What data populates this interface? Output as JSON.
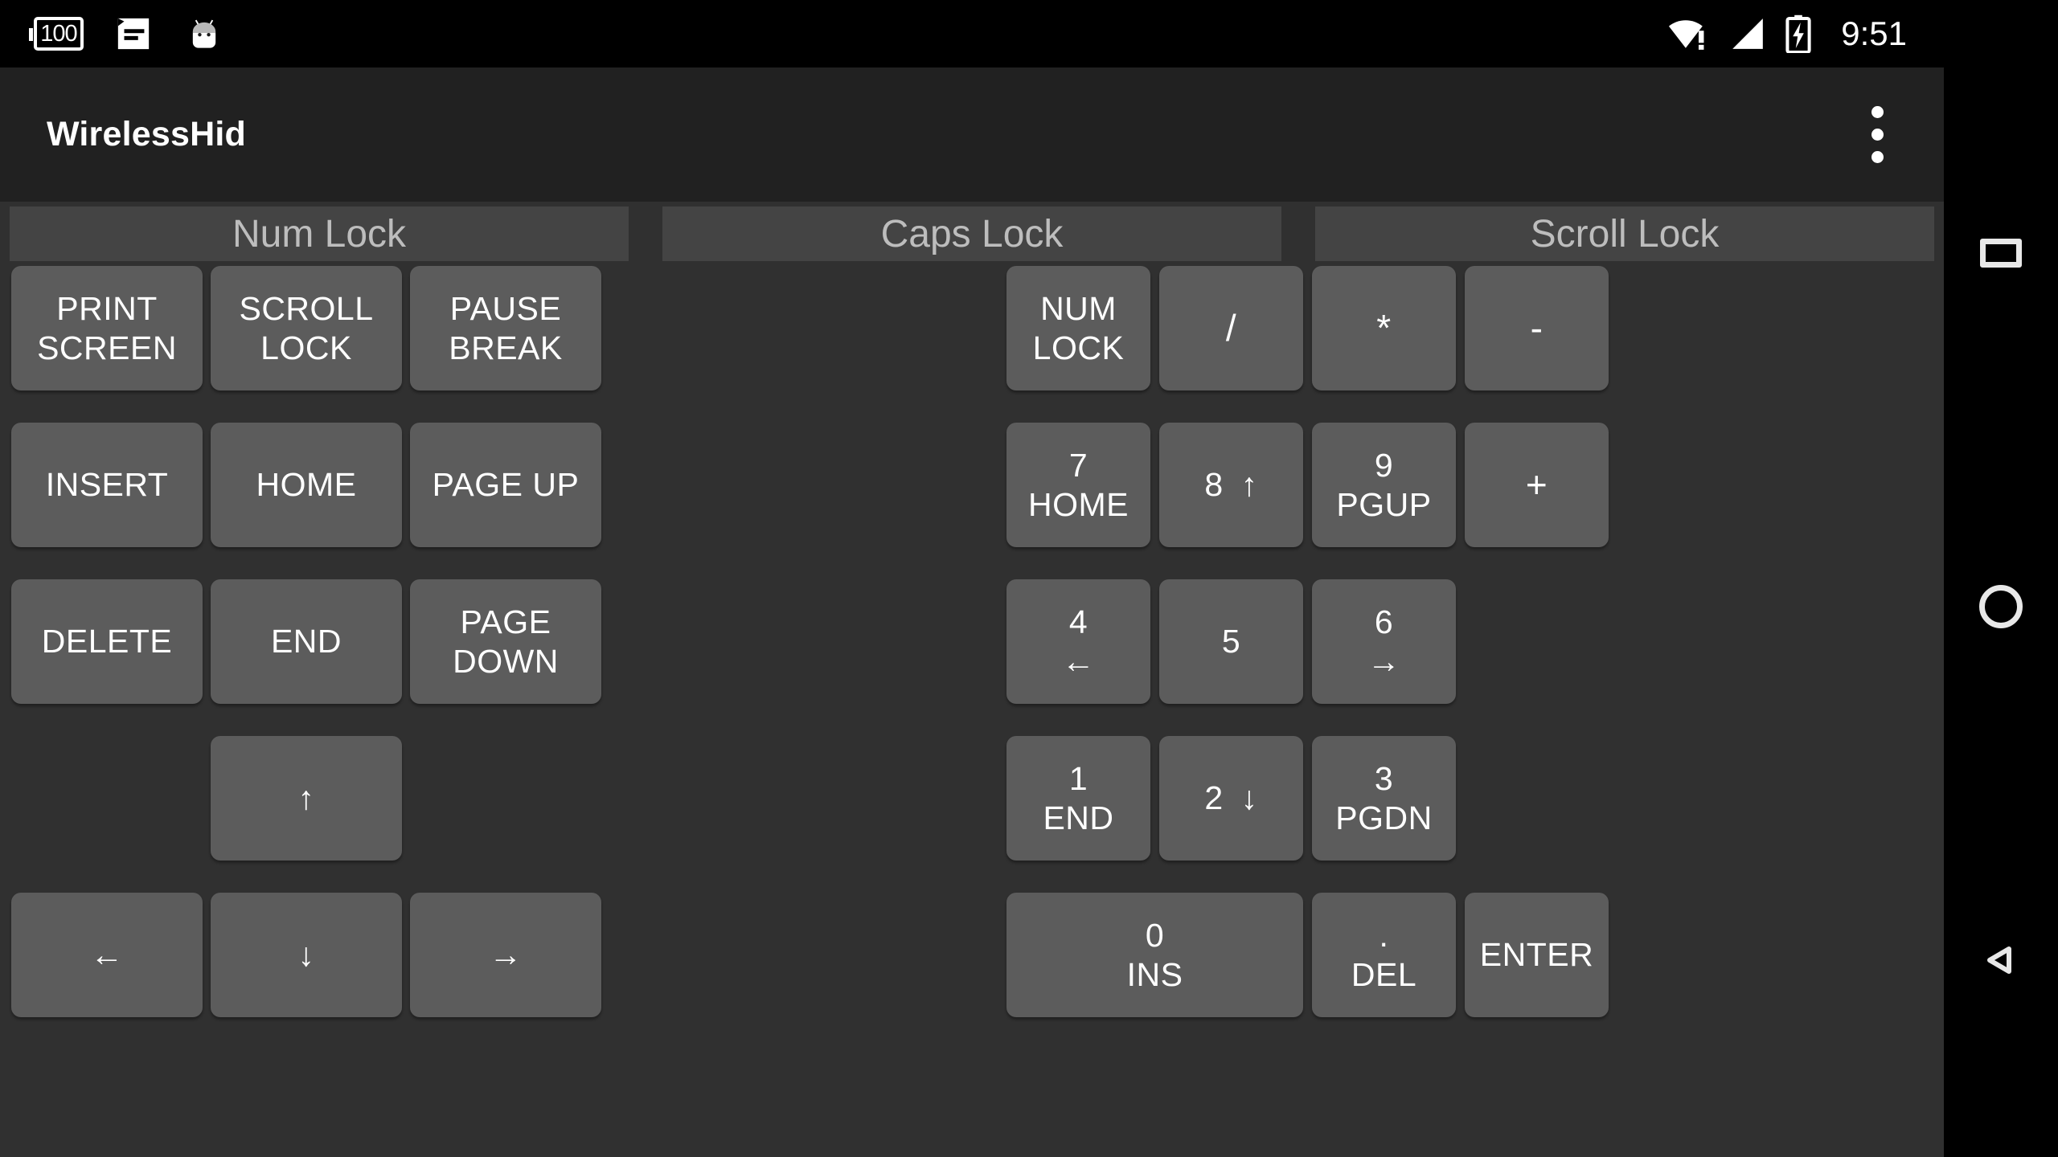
{
  "status_bar": {
    "battery_level_text": "100",
    "icons_left": [
      "battery-level-icon",
      "sms-message-icon",
      "android-mascot-icon"
    ],
    "icons_right": [
      "wifi-no-internet-icon",
      "cellular-signal-icon",
      "battery-charging-icon"
    ],
    "time": "9:51"
  },
  "action_bar": {
    "title": "WirelessHid",
    "overflow_icon": "overflow-menu-icon"
  },
  "lock_row": [
    {
      "label": "Num Lock"
    },
    {
      "label": "Caps Lock"
    },
    {
      "label": "Scroll Lock"
    }
  ],
  "keys": [
    {
      "id": "print-screen",
      "line1": "PRINT",
      "line2": "SCREEN",
      "col": 0,
      "row": 0,
      "w": 1,
      "block": "nav"
    },
    {
      "id": "scroll-lock",
      "line1": "SCROLL",
      "line2": "LOCK",
      "col": 1,
      "row": 0,
      "w": 1,
      "block": "nav"
    },
    {
      "id": "pause-break",
      "line1": "PAUSE",
      "line2": "BREAK",
      "col": 2,
      "row": 0,
      "w": 1,
      "block": "nav"
    },
    {
      "id": "insert",
      "line1": "INSERT",
      "line2": "",
      "col": 0,
      "row": 1,
      "w": 1,
      "block": "nav"
    },
    {
      "id": "home",
      "line1": "HOME",
      "line2": "",
      "col": 1,
      "row": 1,
      "w": 1,
      "block": "nav"
    },
    {
      "id": "page-up",
      "line1": "PAGE UP",
      "line2": "",
      "col": 2,
      "row": 1,
      "w": 1,
      "block": "nav"
    },
    {
      "id": "delete",
      "line1": "DELETE",
      "line2": "",
      "col": 0,
      "row": 2,
      "w": 1,
      "block": "nav"
    },
    {
      "id": "end",
      "line1": "END",
      "line2": "",
      "col": 1,
      "row": 2,
      "w": 1,
      "block": "nav"
    },
    {
      "id": "page-down",
      "line1": "PAGE DOWN",
      "line2": "",
      "col": 2,
      "row": 2,
      "w": 1,
      "block": "nav"
    },
    {
      "id": "arrow-up",
      "line1": "↑",
      "line2": "",
      "col": 1,
      "row": 3,
      "w": 1,
      "block": "nav"
    },
    {
      "id": "arrow-left",
      "line1": "←",
      "line2": "",
      "col": 0,
      "row": 4,
      "w": 1,
      "block": "nav"
    },
    {
      "id": "arrow-down",
      "line1": "↓",
      "line2": "",
      "col": 1,
      "row": 4,
      "w": 1,
      "block": "nav"
    },
    {
      "id": "arrow-right",
      "line1": "→",
      "line2": "",
      "col": 2,
      "row": 4,
      "w": 1,
      "block": "nav"
    },
    {
      "id": "num-lock",
      "line1": "NUM",
      "line2": "LOCK",
      "col": 0,
      "row": 0,
      "w": 1,
      "block": "pad"
    },
    {
      "id": "divide",
      "line1": "/",
      "line2": "",
      "col": 1,
      "row": 0,
      "w": 1,
      "block": "pad",
      "sym": true
    },
    {
      "id": "multiply",
      "line1": "*",
      "line2": "",
      "col": 2,
      "row": 0,
      "w": 1,
      "block": "pad",
      "sym": true
    },
    {
      "id": "minus",
      "line1": "-",
      "line2": "",
      "col": 3,
      "row": 0,
      "w": 1,
      "block": "pad",
      "sym": true
    },
    {
      "id": "numpad-7",
      "line1": "7",
      "line2": "HOME",
      "col": 0,
      "row": 1,
      "w": 1,
      "block": "pad"
    },
    {
      "id": "numpad-8",
      "line1": "8",
      "line2": "↑",
      "col": 1,
      "row": 1,
      "w": 1,
      "block": "pad",
      "inline": true
    },
    {
      "id": "numpad-9",
      "line1": "9",
      "line2": "PGUP",
      "col": 2,
      "row": 1,
      "w": 1,
      "block": "pad"
    },
    {
      "id": "plus",
      "line1": "+",
      "line2": "",
      "col": 3,
      "row": 1,
      "w": 1,
      "block": "pad",
      "sym": true
    },
    {
      "id": "numpad-4",
      "line1": "4",
      "line2": "←",
      "col": 0,
      "row": 2,
      "w": 1,
      "block": "pad"
    },
    {
      "id": "numpad-5",
      "line1": "5",
      "line2": "",
      "col": 1,
      "row": 2,
      "w": 1,
      "block": "pad"
    },
    {
      "id": "numpad-6",
      "line1": "6",
      "line2": "→",
      "col": 2,
      "row": 2,
      "w": 1,
      "block": "pad"
    },
    {
      "id": "numpad-1",
      "line1": "1",
      "line2": "END",
      "col": 0,
      "row": 3,
      "w": 1,
      "block": "pad"
    },
    {
      "id": "numpad-2",
      "line1": "2",
      "line2": "↓",
      "col": 1,
      "row": 3,
      "w": 1,
      "block": "pad",
      "inline": true
    },
    {
      "id": "numpad-3",
      "line1": "3",
      "line2": "PGDN",
      "col": 2,
      "row": 3,
      "w": 1,
      "block": "pad"
    },
    {
      "id": "numpad-0",
      "line1": "0",
      "line2": "INS",
      "col": 0,
      "row": 4,
      "w": 2,
      "block": "pad"
    },
    {
      "id": "numpad-dot",
      "line1": ".",
      "line2": "DEL",
      "col": 2,
      "row": 4,
      "w": 1,
      "block": "pad"
    },
    {
      "id": "enter",
      "line1": "ENTER",
      "line2": "",
      "col": 3,
      "row": 4,
      "w": 1,
      "block": "pad"
    }
  ],
  "nav_bar": {
    "recents_label": "recents-icon",
    "home_label": "home-icon",
    "back_label": "back-icon"
  },
  "colors": {
    "screen_bg": "#000000",
    "app_bg": "#303030",
    "action_bar_bg": "#212121",
    "key_bg": "#5c5c5c",
    "lock_bg": "#444444",
    "key_text": "#ffffff",
    "lock_text": "#bdbdbd"
  }
}
